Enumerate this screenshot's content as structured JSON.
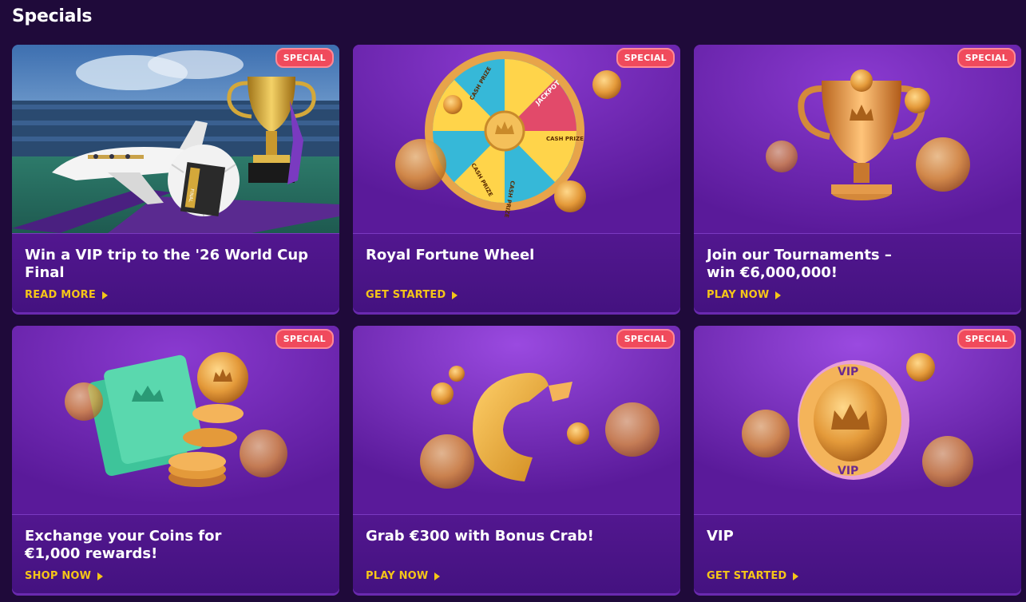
{
  "section": {
    "title": "Specials"
  },
  "cards": [
    {
      "badge": "SPECIAL",
      "title": "Win a VIP trip to the '26 World Cup Final",
      "cta": "READ MORE"
    },
    {
      "badge": "SPECIAL",
      "title": "Royal Fortune Wheel",
      "cta": "GET STARTED"
    },
    {
      "badge": "SPECIAL",
      "title": "Join our Tournaments – win €6,000,000!",
      "cta": "PLAY NOW"
    },
    {
      "badge": "SPECIAL",
      "title": "Exchange your Coins for €1,000 rewards!",
      "cta": "SHOP NOW"
    },
    {
      "badge": "SPECIAL",
      "title": "Grab €300 with Bonus Crab!",
      "cta": "PLAY NOW"
    },
    {
      "badge": "SPECIAL",
      "title": "VIP",
      "cta": "GET STARTED"
    }
  ],
  "art": {
    "card0": {
      "ticket_text": "FINAL"
    },
    "card1": {
      "wheel_texts": [
        "JACKPOT",
        "CASH PRIZE",
        "CASH PRIZE",
        "CASH PRIZE",
        "CASH PRIZE"
      ]
    },
    "card5": {
      "coin_top": "VIP",
      "coin_bottom": "VIP"
    }
  },
  "colors": {
    "background": "#1f0a3a",
    "card": "#4a1488",
    "accent_cta": "#f5c518",
    "badge": "#f04a5c"
  },
  "icons": [
    "play-arrow-icon",
    "crown-icon",
    "coin-icon",
    "trophy-icon",
    "ticket-icon",
    "wheel-icon"
  ]
}
